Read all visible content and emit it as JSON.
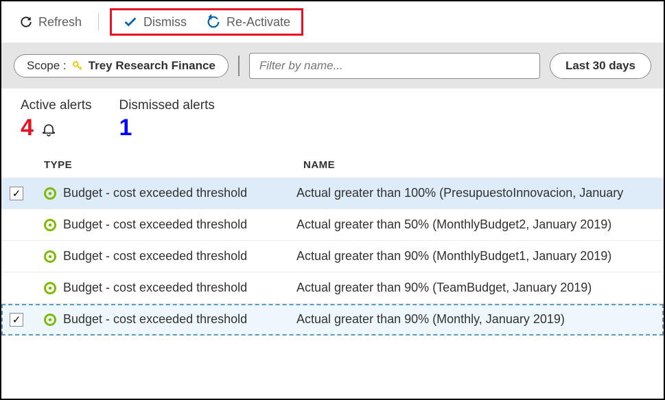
{
  "toolbar": {
    "refresh_label": "Refresh",
    "dismiss_label": "Dismiss",
    "reactivate_label": "Re-Activate"
  },
  "filter": {
    "scope_prefix": "Scope :",
    "scope_value": "Trey Research Finance",
    "search_placeholder": "Filter by name...",
    "range_label": "Last 30 days"
  },
  "stats": {
    "active_label": "Active alerts",
    "active_value": "4",
    "dismissed_label": "Dismissed alerts",
    "dismissed_value": "1"
  },
  "columns": {
    "type": "TYPE",
    "name": "NAME"
  },
  "rows": [
    {
      "selected": true,
      "type": "Budget - cost exceeded threshold",
      "name": "Actual greater than 100% (PresupuestoInnovacion, January "
    },
    {
      "selected": false,
      "type": "Budget - cost exceeded threshold",
      "name": "Actual greater than 50% (MonthlyBudget2, January 2019)"
    },
    {
      "selected": false,
      "type": "Budget - cost exceeded threshold",
      "name": "Actual greater than 90% (MonthlyBudget1, January 2019)"
    },
    {
      "selected": false,
      "type": "Budget - cost exceeded threshold",
      "name": "Actual greater than 90% (TeamBudget, January 2019)"
    },
    {
      "selected": true,
      "type": "Budget - cost exceeded threshold",
      "name": "Actual greater than 90% (Monthly, January 2019)"
    }
  ],
  "checkbox_mark": "✓"
}
